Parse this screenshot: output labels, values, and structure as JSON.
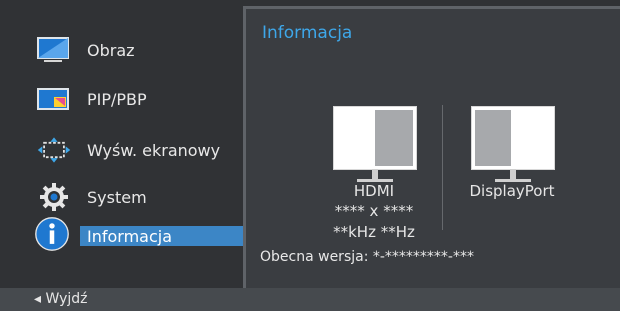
{
  "menu": {
    "items": [
      {
        "label": "Obraz",
        "icon": "picture-icon"
      },
      {
        "label": "PIP/PBP",
        "icon": "pip-pbp-icon"
      },
      {
        "label": "Wyśw. ekranowy",
        "icon": "onscreen-display-icon"
      },
      {
        "label": "System",
        "icon": "gear-icon"
      },
      {
        "label": "Informacja",
        "icon": "info-icon",
        "selected": true
      }
    ]
  },
  "panel": {
    "title": "Informacja",
    "left_monitor": {
      "source": "HDMI",
      "resolution": "**** x ****",
      "frequency": "**kHz **Hz"
    },
    "right_monitor": {
      "source": "DisplayPort"
    },
    "version": "Obecna wersja: *-*********-***"
  },
  "footer": {
    "exit": "◂ Wyjdź"
  },
  "colors": {
    "accent": "#3ea7e9",
    "selection": "#3c86c6",
    "background": "#303235",
    "panel": "#3a3d41"
  }
}
